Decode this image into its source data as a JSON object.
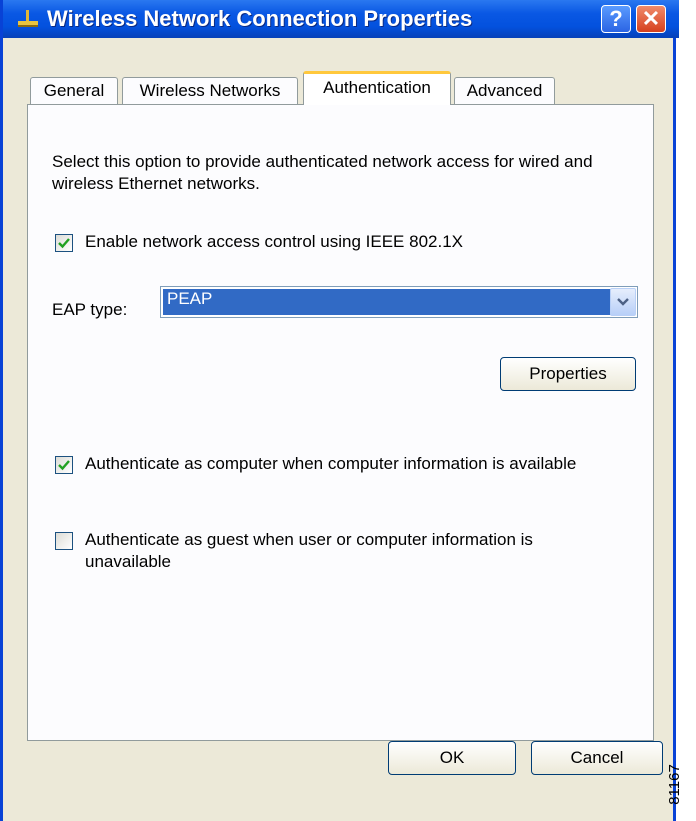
{
  "window": {
    "title": "Wireless Network Connection Properties",
    "help_button": "?",
    "close_button": "✕"
  },
  "tabs": [
    {
      "label": "General",
      "selected": false
    },
    {
      "label": "Wireless Networks",
      "selected": false
    },
    {
      "label": "Authentication",
      "selected": true
    },
    {
      "label": "Advanced",
      "selected": false
    }
  ],
  "authentication": {
    "description": "Select this option to provide authenticated network access for wired and wireless Ethernet networks.",
    "enable_8021x": {
      "label": "Enable network access control using IEEE 802.1X",
      "checked": true
    },
    "eap_type_label": "EAP type:",
    "eap_type_value": "PEAP",
    "properties_button": "Properties",
    "auth_as_computer": {
      "label": "Authenticate as computer when computer information is available",
      "checked": true
    },
    "auth_as_guest": {
      "label": "Authenticate as guest when user or computer information is unavailable",
      "checked": false
    }
  },
  "footer": {
    "ok_button": "OK",
    "cancel_button": "Cancel"
  },
  "figure_id": "81167",
  "colors": {
    "titlebar": "#0a58e4",
    "dialog_bg": "#ece9d8",
    "selection": "#316ac5",
    "check": "#21a121"
  }
}
